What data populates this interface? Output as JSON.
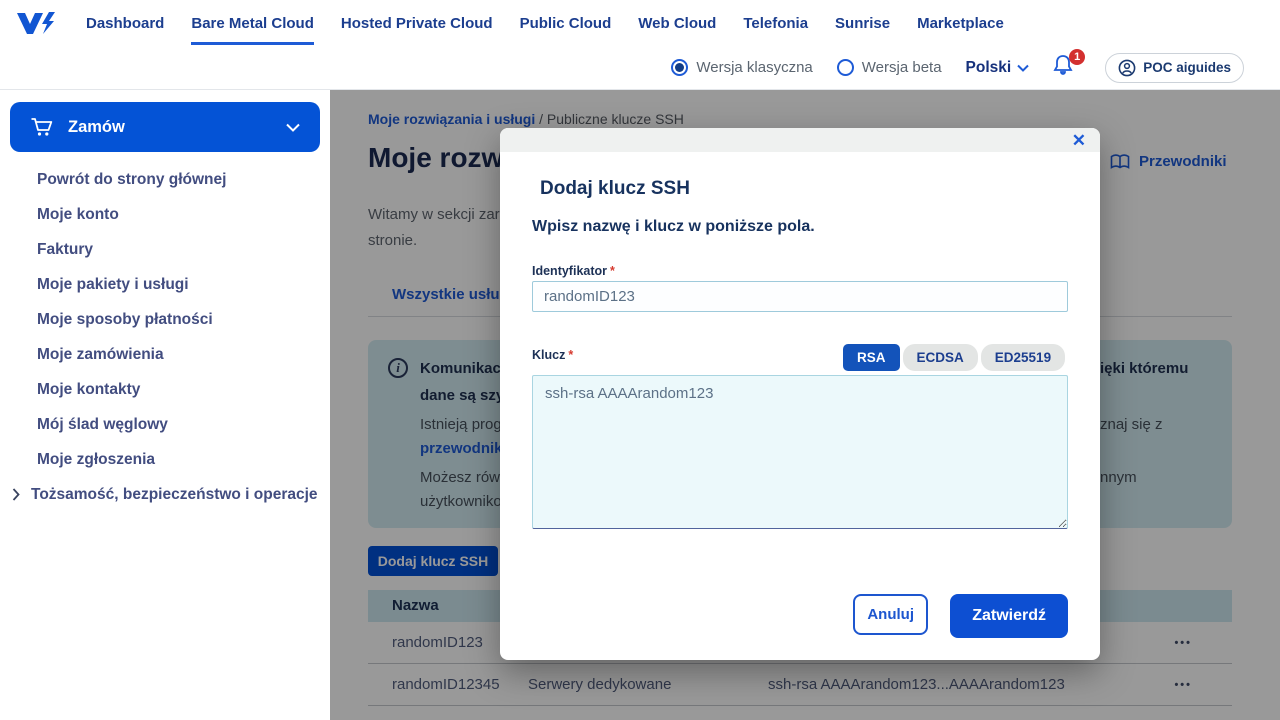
{
  "colors": {
    "accent_blue": "#0050d7",
    "link_blue": "#1e5bd6",
    "navy_text": "#1b3a70",
    "badge_red": "#d3302f",
    "info_banner_bg": "#d3ecf2",
    "selected_segment_bg": "#1353ba"
  },
  "topnav": {
    "items": [
      {
        "label": "Dashboard"
      },
      {
        "label": "Bare Metal Cloud"
      },
      {
        "label": "Hosted Private Cloud"
      },
      {
        "label": "Public Cloud"
      },
      {
        "label": "Web Cloud"
      },
      {
        "label": "Telefonia"
      },
      {
        "label": "Sunrise"
      },
      {
        "label": "Marketplace"
      }
    ],
    "active_item": "Bare Metal Cloud"
  },
  "utilitybar": {
    "version_classic": "Wersja klasyczna",
    "version_beta": "Wersja beta",
    "language": "Polski",
    "notification_count": "1",
    "account": "POC aiguides"
  },
  "sidebar": {
    "order_button": "Zamów",
    "items": [
      {
        "label": "Powrót do strony głównej"
      },
      {
        "label": "Moje konto"
      },
      {
        "label": "Faktury"
      },
      {
        "label": "Moje pakiety i usługi"
      },
      {
        "label": "Moje sposoby płatności"
      },
      {
        "label": "Moje zamówienia"
      },
      {
        "label": "Moje kontakty"
      },
      {
        "label": "Mój ślad węglowy"
      },
      {
        "label": "Moje zgłoszenia"
      },
      {
        "label": "Tożsamość, bezpieczeństwo i operacje"
      }
    ]
  },
  "page": {
    "breadcrumb_root": "Moje rozwiązania i usługi",
    "breadcrumb_sep": "/",
    "breadcrumb_current": "Publiczne klucze SSH",
    "heading_visible": "Moje rozwi",
    "guides_link": "Przewodniki",
    "intro_line1": "Witamy w sekcji zarz",
    "intro_line2": "stronie.",
    "tab_all_services": "Wszystkie usług",
    "info_banner": {
      "left_line1": "Komunikacj",
      "left_line2": "dane są szyf",
      "left_line3": "Istnieją prog",
      "left_link": "przewodnik",
      "left_line4": "Możesz rów",
      "left_line5": "użytkowniko",
      "right_line1": "ięki któremu",
      "right_line2": "znaj się z",
      "right_line3": "nnym"
    },
    "add_key_button": "Dodaj klucz SSH",
    "table": {
      "header_name": "Nazwa",
      "actions_icon": "•••",
      "rows": [
        {
          "name": "randomID123"
        },
        {
          "name": "randomID12345",
          "type": "Serwery dedykowane",
          "key": "ssh-rsa AAAArandom123...AAAArandom123"
        }
      ]
    }
  },
  "modal": {
    "title": "Dodaj klucz SSH",
    "close": "✕",
    "subtitle": "Wpisz nazwę i klucz w poniższe pola.",
    "identifier_label": "Identyfikator",
    "required_mark": "*",
    "identifier_value": "randomID123",
    "key_label": "Klucz",
    "key_types": [
      {
        "label": "RSA"
      },
      {
        "label": "ECDSA"
      },
      {
        "label": "ED25519"
      }
    ],
    "selected_key_type": "RSA",
    "key_value": "ssh-rsa AAAArandom123",
    "cancel_button": "Anuluj",
    "submit_button": "Zatwierdź"
  }
}
